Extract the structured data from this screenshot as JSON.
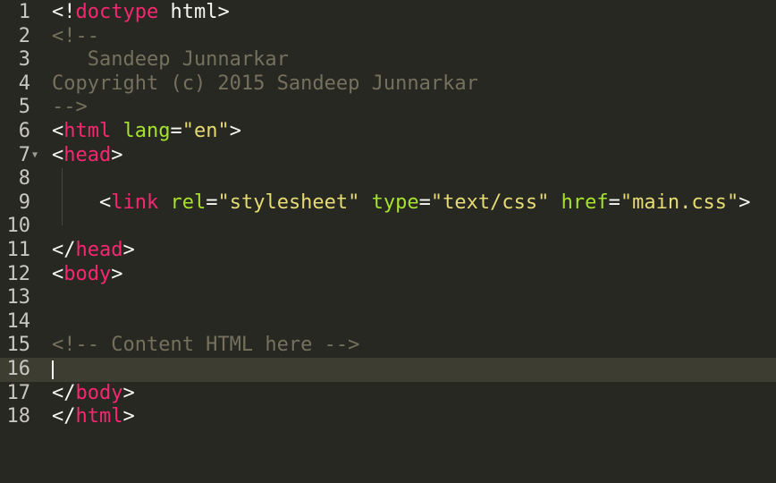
{
  "editor": {
    "theme_colors": {
      "background": "#272822",
      "current_line": "#3e3d32",
      "plain": "#f8f8f2",
      "tag": "#f92672",
      "attribute": "#a6e22e",
      "string": "#e6db74",
      "comment": "#75715e",
      "gutter_text": "#c8c8c0"
    },
    "current_line": 16,
    "fold_marker_icon": "fold-triangle-down",
    "fold_marker_glyph": "▼",
    "lines": [
      {
        "num": "1",
        "tokens": [
          [
            "p",
            "<!"
          ],
          [
            "t",
            "doctype"
          ],
          [
            "p",
            " html>"
          ]
        ]
      },
      {
        "num": "2",
        "tokens": [
          [
            "c",
            "<!--"
          ]
        ]
      },
      {
        "num": "3",
        "tokens": [
          [
            "c",
            "   Sandeep Junnarkar"
          ]
        ]
      },
      {
        "num": "4",
        "tokens": [
          [
            "c",
            "Copyright (c) 2015 Sandeep Junnarkar"
          ]
        ]
      },
      {
        "num": "5",
        "tokens": [
          [
            "c",
            "-->"
          ]
        ]
      },
      {
        "num": "6",
        "tokens": [
          [
            "p",
            "<"
          ],
          [
            "t",
            "html"
          ],
          [
            "p",
            " "
          ],
          [
            "a",
            "lang"
          ],
          [
            "p",
            "="
          ],
          [
            "s",
            "\"en\""
          ],
          [
            "p",
            ">"
          ]
        ]
      },
      {
        "num": "7",
        "tokens": [
          [
            "p",
            "<"
          ],
          [
            "t",
            "head"
          ],
          [
            "p",
            ">"
          ]
        ],
        "fold": true
      },
      {
        "num": "8",
        "tokens": []
      },
      {
        "num": "9",
        "tokens": [
          [
            "p",
            "    <"
          ],
          [
            "t",
            "link"
          ],
          [
            "p",
            " "
          ],
          [
            "a",
            "rel"
          ],
          [
            "p",
            "="
          ],
          [
            "s",
            "\"stylesheet\""
          ],
          [
            "p",
            " "
          ],
          [
            "a",
            "type"
          ],
          [
            "p",
            "="
          ],
          [
            "s",
            "\"text/css\""
          ],
          [
            "p",
            " "
          ],
          [
            "a",
            "href"
          ],
          [
            "p",
            "="
          ],
          [
            "s",
            "\"main.css\""
          ],
          [
            "p",
            ">"
          ]
        ]
      },
      {
        "num": "10",
        "tokens": []
      },
      {
        "num": "11",
        "tokens": [
          [
            "p",
            "</"
          ],
          [
            "t",
            "head"
          ],
          [
            "p",
            ">"
          ]
        ]
      },
      {
        "num": "12",
        "tokens": [
          [
            "p",
            "<"
          ],
          [
            "t",
            "body"
          ],
          [
            "p",
            ">"
          ]
        ]
      },
      {
        "num": "13",
        "tokens": []
      },
      {
        "num": "14",
        "tokens": []
      },
      {
        "num": "15",
        "tokens": [
          [
            "c",
            "<!-- Content HTML here -->"
          ]
        ]
      },
      {
        "num": "16",
        "tokens": [],
        "caret": true
      },
      {
        "num": "17",
        "tokens": [
          [
            "p",
            "</"
          ],
          [
            "t",
            "body"
          ],
          [
            "p",
            ">"
          ]
        ]
      },
      {
        "num": "18",
        "tokens": [
          [
            "p",
            "</"
          ],
          [
            "t",
            "html"
          ],
          [
            "p",
            ">"
          ]
        ]
      }
    ]
  }
}
